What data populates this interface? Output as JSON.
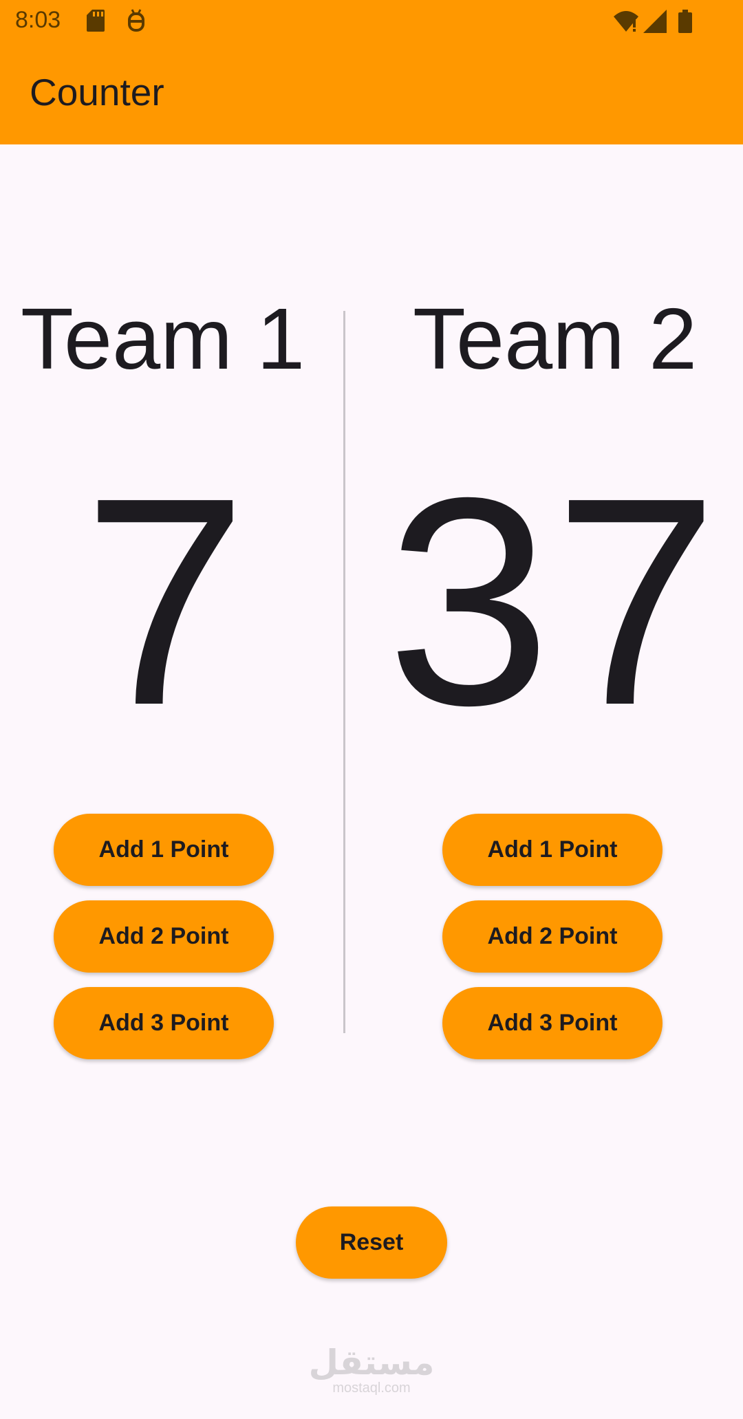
{
  "status_bar": {
    "time": "8:03",
    "icons": [
      "sd-card-icon",
      "android-debug-icon",
      "wifi-alert-icon",
      "cell-signal-icon",
      "battery-icon"
    ]
  },
  "app_bar": {
    "title": "Counter"
  },
  "team1": {
    "name": "Team 1",
    "score": "7",
    "buttons": [
      "Add 1 Point",
      "Add 2 Point",
      "Add 3 Point"
    ]
  },
  "team2": {
    "name": "Team 2",
    "score": "37",
    "buttons": [
      "Add 1 Point",
      "Add 2 Point",
      "Add 3 Point"
    ]
  },
  "reset_label": "Reset",
  "watermark": {
    "logo": "مستقل",
    "url": "mostaql.com"
  },
  "colors": {
    "primary": "#ff9800",
    "background": "#fdf7fc",
    "text": "#1d1b20",
    "divider": "#c9c5ca"
  }
}
